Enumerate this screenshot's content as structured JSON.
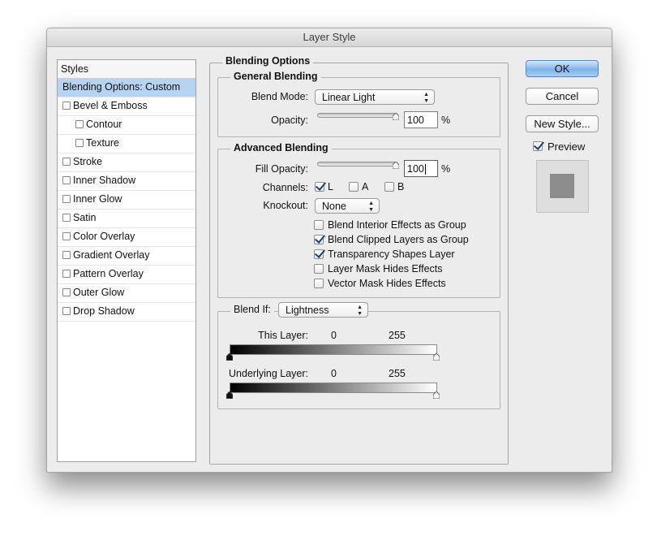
{
  "window": {
    "title": "Layer Style"
  },
  "styles": {
    "header": "Styles",
    "items": [
      {
        "label": "Blending Options: Custom",
        "checkbox": false,
        "sub": false,
        "selected": true
      },
      {
        "label": "Bevel & Emboss",
        "checkbox": true,
        "sub": false
      },
      {
        "label": "Contour",
        "checkbox": true,
        "sub": true
      },
      {
        "label": "Texture",
        "checkbox": true,
        "sub": true
      },
      {
        "label": "Stroke",
        "checkbox": true,
        "sub": false
      },
      {
        "label": "Inner Shadow",
        "checkbox": true,
        "sub": false
      },
      {
        "label": "Inner Glow",
        "checkbox": true,
        "sub": false
      },
      {
        "label": "Satin",
        "checkbox": true,
        "sub": false
      },
      {
        "label": "Color Overlay",
        "checkbox": true,
        "sub": false
      },
      {
        "label": "Gradient Overlay",
        "checkbox": true,
        "sub": false
      },
      {
        "label": "Pattern Overlay",
        "checkbox": true,
        "sub": false
      },
      {
        "label": "Outer Glow",
        "checkbox": true,
        "sub": false
      },
      {
        "label": "Drop Shadow",
        "checkbox": true,
        "sub": false
      }
    ]
  },
  "blending": {
    "title": "Blending Options",
    "general": {
      "title": "General Blending",
      "blend_mode_label": "Blend Mode:",
      "blend_mode_value": "Linear Light",
      "opacity_label": "Opacity:",
      "opacity_value": "100",
      "opacity_unit": "%",
      "opacity_level": 1.0
    },
    "advanced": {
      "title": "Advanced Blending",
      "fill_opacity_label": "Fill Opacity:",
      "fill_opacity_value": "100",
      "fill_opacity_unit": "%",
      "fill_opacity_level": 1.0,
      "channels_label": "Channels:",
      "channels": [
        {
          "label": "L",
          "checked": true
        },
        {
          "label": "A",
          "checked": false
        },
        {
          "label": "B",
          "checked": false
        }
      ],
      "knockout_label": "Knockout:",
      "knockout_value": "None",
      "options": [
        {
          "label": "Blend Interior Effects as Group",
          "checked": false
        },
        {
          "label": "Blend Clipped Layers as Group",
          "checked": true
        },
        {
          "label": "Transparency Shapes Layer",
          "checked": true
        },
        {
          "label": "Layer Mask Hides Effects",
          "checked": false
        },
        {
          "label": "Vector Mask Hides Effects",
          "checked": false
        }
      ]
    },
    "blend_if": {
      "label": "Blend If:",
      "value": "Lightness",
      "this_layer_label": "This Layer:",
      "this_layer_min": "0",
      "this_layer_max": "255",
      "underlying_label": "Underlying Layer:",
      "underlying_min": "0",
      "underlying_max": "255"
    }
  },
  "buttons": {
    "ok": "OK",
    "cancel": "Cancel",
    "new_style": "New Style...",
    "preview_label": "Preview",
    "preview_checked": true
  },
  "colors": {
    "selection": "#b7d3f2",
    "default_button": "#7eb4ee",
    "preview_swatch": "#8c8c8c"
  }
}
